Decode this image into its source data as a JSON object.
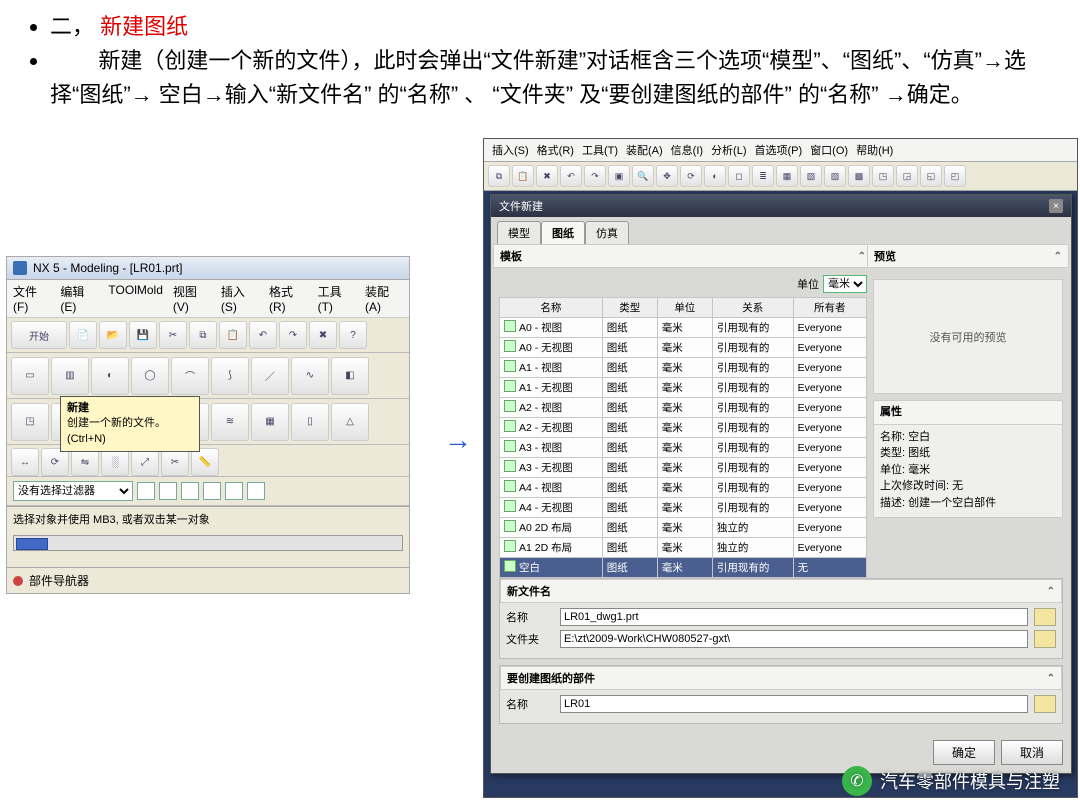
{
  "intro": {
    "bullet1_num": "二，",
    "bullet1_red": "新建图纸",
    "bullet2": "新建（创建一个新的文件），此时会弹出“文件新建”对话框含三个选项“模型”、“图纸”、“仿真”→选择“图纸”→ 空白→输入“新文件名” 的“名称” 、 “文件夹” 及“要创建图纸的部件” 的“名称” →确定。"
  },
  "arrow": "→",
  "left": {
    "title": "NX 5 - Modeling - [LR01.prt]",
    "menu": [
      "文件(F)",
      "编辑(E)",
      "TOOlMold",
      "视图(V)",
      "插入(S)",
      "格式(R)",
      "工具(T)",
      "装配(A)"
    ],
    "start": "开始",
    "tooltip_title": "新建",
    "tooltip_line1": "创建一个新的文件。",
    "tooltip_key": "(Ctrl+N)",
    "filter": "没有选择过滤器",
    "status": "选择对象并使用 MB3, 或者双击某一对象",
    "nav": "部件导航器"
  },
  "right_menu": [
    "插入(S)",
    "格式(R)",
    "工具(T)",
    "装配(A)",
    "信息(I)",
    "分析(L)",
    "首选项(P)",
    "窗口(O)",
    "帮助(H)"
  ],
  "dialog": {
    "title": "文件新建",
    "tabs": [
      "模型",
      "图纸",
      "仿真"
    ],
    "active_tab_index": 1,
    "section_templates": "模板",
    "section_preview": "预览",
    "units_label": "单位",
    "units_value": "毫米",
    "cols": [
      "名称",
      "类型",
      "单位",
      "关系",
      "所有者"
    ],
    "rows": [
      {
        "n": "A0 - 视图",
        "t": "图纸",
        "u": "毫米",
        "r": "引用现有的",
        "o": "Everyone"
      },
      {
        "n": "A0 - 无视图",
        "t": "图纸",
        "u": "毫米",
        "r": "引用现有的",
        "o": "Everyone"
      },
      {
        "n": "A1 - 视图",
        "t": "图纸",
        "u": "毫米",
        "r": "引用现有的",
        "o": "Everyone"
      },
      {
        "n": "A1 - 无视图",
        "t": "图纸",
        "u": "毫米",
        "r": "引用现有的",
        "o": "Everyone"
      },
      {
        "n": "A2 - 视图",
        "t": "图纸",
        "u": "毫米",
        "r": "引用现有的",
        "o": "Everyone"
      },
      {
        "n": "A2 - 无视图",
        "t": "图纸",
        "u": "毫米",
        "r": "引用现有的",
        "o": "Everyone"
      },
      {
        "n": "A3 - 视图",
        "t": "图纸",
        "u": "毫米",
        "r": "引用现有的",
        "o": "Everyone"
      },
      {
        "n": "A3 - 无视图",
        "t": "图纸",
        "u": "毫米",
        "r": "引用现有的",
        "o": "Everyone"
      },
      {
        "n": "A4 - 视图",
        "t": "图纸",
        "u": "毫米",
        "r": "引用现有的",
        "o": "Everyone"
      },
      {
        "n": "A4 - 无视图",
        "t": "图纸",
        "u": "毫米",
        "r": "引用现有的",
        "o": "Everyone"
      },
      {
        "n": "A0 2D 布局",
        "t": "图纸",
        "u": "毫米",
        "r": "独立的",
        "o": "Everyone"
      },
      {
        "n": "A1 2D 布局",
        "t": "图纸",
        "u": "毫米",
        "r": "独立的",
        "o": "Everyone"
      },
      {
        "n": "空白",
        "t": "图纸",
        "u": "毫米",
        "r": "引用现有的",
        "o": "无"
      }
    ],
    "selected_row_index": 12,
    "preview_empty": "没有可用的预览",
    "props_head": "属性",
    "props": {
      "name_k": "名称:",
      "name_v": "空白",
      "type_k": "类型:",
      "type_v": "图纸",
      "unit_k": "单位:",
      "unit_v": "毫米",
      "time_k": "上次修改时间:",
      "time_v": "无",
      "desc_k": "描述:",
      "desc_v": "创建一个空白部件"
    },
    "sec_newfile": "新文件名",
    "newfile_name_lbl": "名称",
    "newfile_name_val": "LR01_dwg1.prt",
    "newfile_dir_lbl": "文件夹",
    "newfile_dir_val": "E:\\zt\\2009-Work\\CHW080527-gxt\\",
    "sec_part": "要创建图纸的部件",
    "part_name_lbl": "名称",
    "part_name_val": "LR01",
    "btn_ok": "确定",
    "btn_cancel": "取消"
  },
  "wechat": "汽车零部件模具与注塑"
}
